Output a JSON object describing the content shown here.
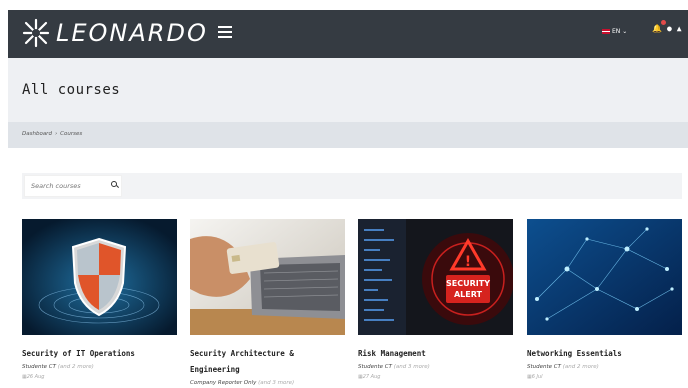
{
  "brand": {
    "name": "LEONARDO"
  },
  "header": {
    "language": "EN"
  },
  "page": {
    "title": "All courses"
  },
  "breadcrumb": {
    "items": [
      "Dashboard",
      "Courses"
    ]
  },
  "search": {
    "placeholder": "Search courses"
  },
  "courses": [
    {
      "title": "Security of IT Operations",
      "audience": "Studente CT",
      "more": "(and 2 more)",
      "date": "26 Aug"
    },
    {
      "title": "Security Architecture & Engineering",
      "audience": "Company Reporter Only",
      "more": "(and 3 more)",
      "date": ""
    },
    {
      "title": "Risk Management",
      "audience": "Studente CT",
      "more": "(and 3 more)",
      "date": "27 Aug"
    },
    {
      "title": "Networking Essentials",
      "audience": "Studente CT",
      "more": "(and 2 more)",
      "date": "6 Jul"
    }
  ],
  "colors": {
    "navbar": "#353b42",
    "header_band": "#eef0f3",
    "breadcrumb_band": "#dfe3e8"
  }
}
